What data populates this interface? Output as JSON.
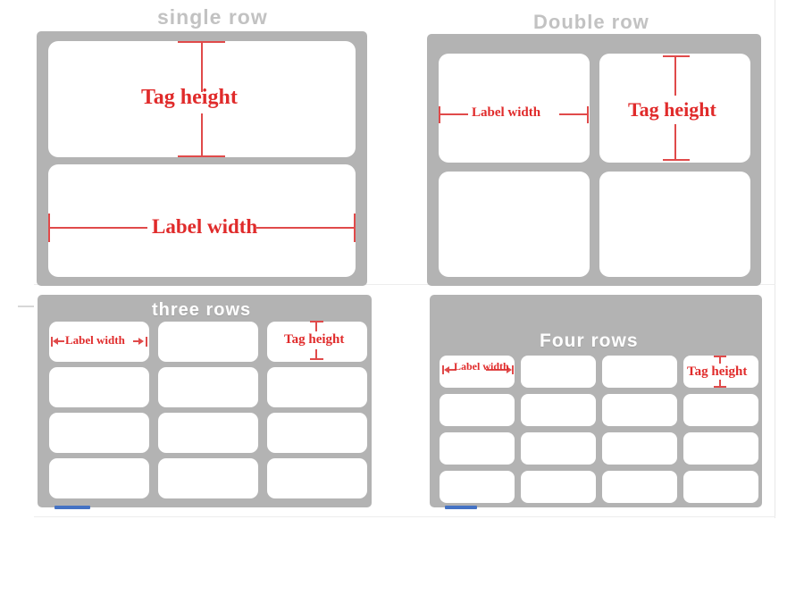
{
  "diagram": {
    "title_color": "#c2c2c2",
    "sheet_color": "#b3b3b3",
    "label_color": "#ffffff",
    "annotation_color": "#e02b2b",
    "marker_color": "#4472c4"
  },
  "panels": [
    {
      "id": "single-row",
      "title": "single row",
      "title_placement": "above-sheet",
      "columns": 1,
      "rows": 2,
      "label_width_text": "Label width",
      "tag_height_text": "Tag height",
      "label_width_cell": "row-2-col-1",
      "tag_height_cell": "row-1-col-1"
    },
    {
      "id": "double-row",
      "title": "Double row",
      "title_placement": "above-sheet",
      "columns": 2,
      "rows": 2,
      "label_width_text": "Label width",
      "tag_height_text": "Tag height",
      "label_width_cell": "row-1-col-1",
      "tag_height_cell": "row-1-col-2"
    },
    {
      "id": "three-rows",
      "title": "three rows",
      "title_placement": "inside-sheet",
      "columns": 3,
      "rows": 4,
      "label_width_text": "Label width",
      "tag_height_text": "Tag height",
      "label_width_cell": "row-1-col-1",
      "tag_height_cell": "row-1-col-3"
    },
    {
      "id": "four-rows",
      "title": "Four rows",
      "title_placement": "inside-sheet",
      "columns": 4,
      "rows": 4,
      "label_width_text": "Label width",
      "tag_height_text": "Tag height",
      "label_width_cell": "row-1-col-1",
      "tag_height_cell": "row-1-col-4"
    }
  ]
}
